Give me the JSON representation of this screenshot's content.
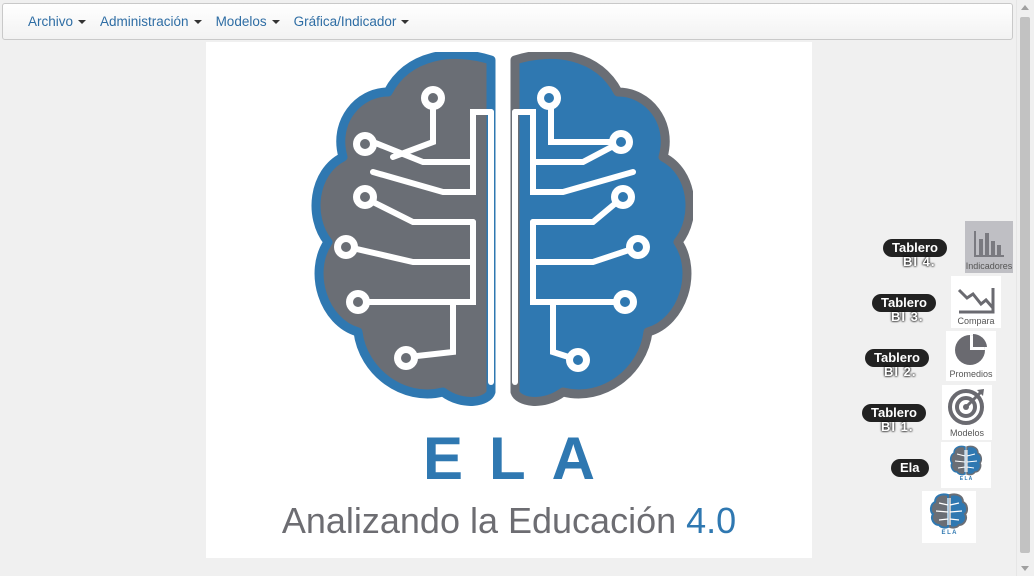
{
  "menu": {
    "items": [
      {
        "label": "Archivo"
      },
      {
        "label": "Administración"
      },
      {
        "label": "Modelos"
      },
      {
        "label": "Gráfica/Indicador"
      }
    ]
  },
  "logo": {
    "title": "ELA",
    "subtitle": "Analizando la Educación",
    "version": "4.0",
    "colors": {
      "blue": "#2f78b1",
      "gray": "#6d6d72"
    }
  },
  "dock": {
    "items": [
      {
        "label": "Tablero",
        "sub": "BI 4.",
        "icon_caption": "Indicadores",
        "icon": "bar-chart-icon"
      },
      {
        "label": "Tablero",
        "sub": "BI 3.",
        "icon_caption": "Compara",
        "icon": "trend-down-icon"
      },
      {
        "label": "Tablero",
        "sub": "BI 2.",
        "icon_caption": "Promedios",
        "icon": "pie-chart-icon"
      },
      {
        "label": "Tablero",
        "sub": "BI 1.",
        "icon_caption": "Modelos",
        "icon": "target-icon"
      },
      {
        "label": "Ela",
        "icon": "ela-logo-icon"
      }
    ]
  }
}
